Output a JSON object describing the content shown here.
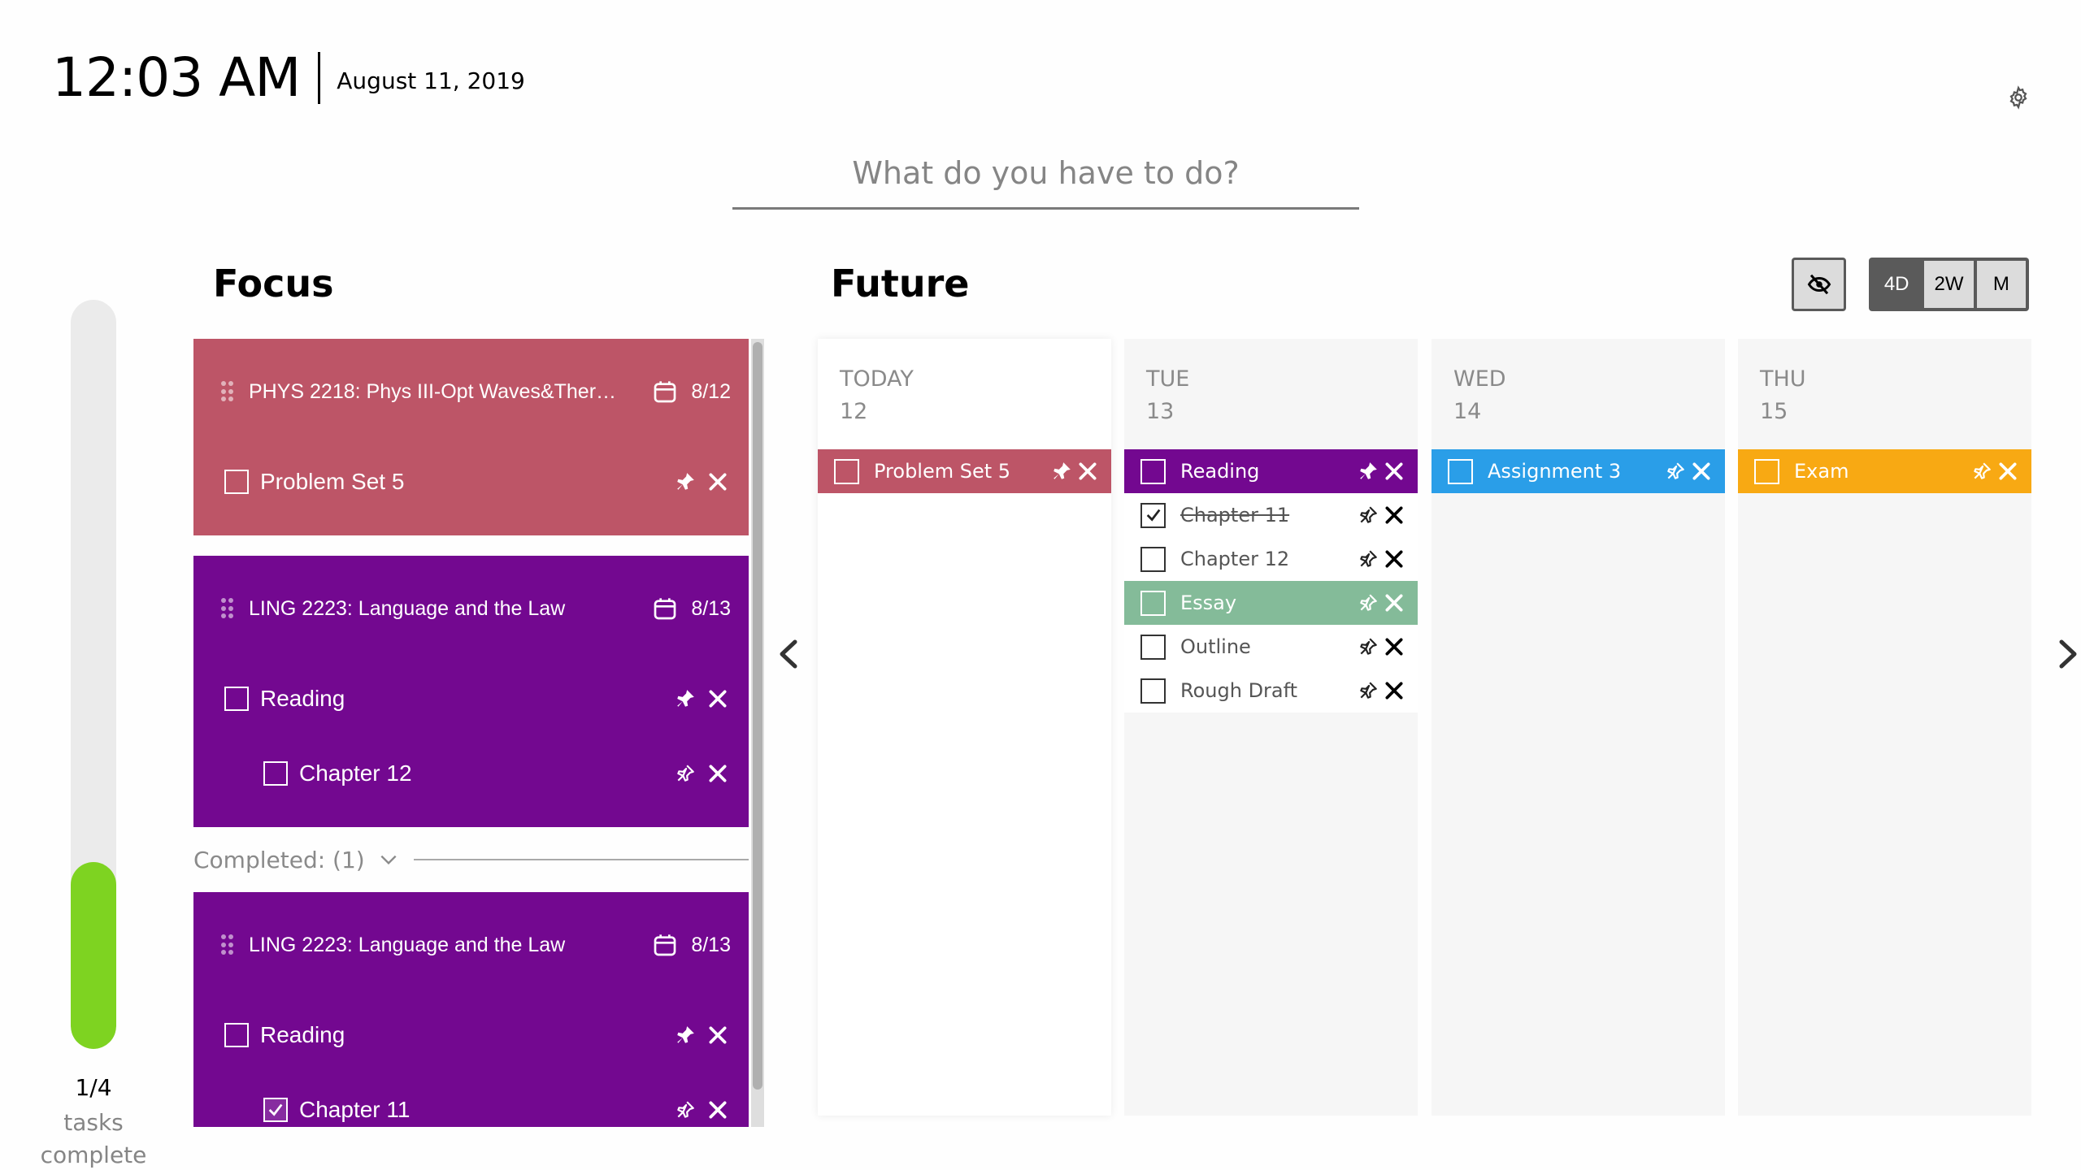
{
  "header": {
    "time": "12:03 AM",
    "date": "August 11, 2019"
  },
  "search": {
    "placeholder": "What do you have to do?",
    "value": ""
  },
  "icons": {
    "settings": "gear-icon",
    "hide_completed": "eye-slash-icon",
    "prev": "chevron-left-icon",
    "next": "chevron-right-icon",
    "due": "calendar-icon",
    "pin": "pin-icon",
    "remove": "close-icon",
    "drag": "drag-handle-icon"
  },
  "colors": {
    "phys": "#bd5567",
    "ling": "#730890",
    "essay": "#84bb99",
    "assignment": "#2a9ee8",
    "exam": "#f8a913",
    "progress": "#7ed321"
  },
  "progress": {
    "completed": 1,
    "total": 4,
    "fraction": 0.25,
    "count_text": "1/4",
    "label": "tasks complete"
  },
  "focus": {
    "title": "Focus",
    "cards": [
      {
        "course": "PHYS 2218: Phys III-Opt Waves&Therm...",
        "due": "8/12",
        "color": "#bd5567",
        "tasks": [
          {
            "label": "Problem Set 5",
            "checked": false,
            "pinned": true,
            "level": 0
          }
        ]
      },
      {
        "course": "LING 2223: Language and the Law",
        "due": "8/13",
        "color": "#730890",
        "tasks": [
          {
            "label": "Reading",
            "checked": false,
            "pinned": true,
            "level": 0
          },
          {
            "label": "Chapter 12",
            "checked": false,
            "pinned": false,
            "level": 1
          }
        ]
      }
    ],
    "completed_label": "Completed: (1)",
    "completed_cards": [
      {
        "course": "LING 2223: Language and the Law",
        "due": "8/13",
        "color": "#730890",
        "tasks": [
          {
            "label": "Reading",
            "checked": false,
            "pinned": true,
            "level": 0
          },
          {
            "label": "Chapter 11",
            "checked": true,
            "pinned": false,
            "level": 1
          }
        ]
      }
    ]
  },
  "future": {
    "title": "Future",
    "view_options": [
      {
        "label": "4D",
        "active": true
      },
      {
        "label": "2W",
        "active": false
      },
      {
        "label": "M",
        "active": false
      }
    ],
    "days": [
      {
        "name": "TODAY",
        "num": "12",
        "today": true,
        "tasks": [
          {
            "label": "Problem Set 5",
            "color": "#bd5567",
            "checked": false,
            "pinned": true
          }
        ]
      },
      {
        "name": "TUE",
        "num": "13",
        "today": false,
        "tasks": [
          {
            "label": "Reading",
            "color": "#730890",
            "checked": false,
            "pinned": true
          },
          {
            "label": "Chapter 11",
            "color": null,
            "checked": true,
            "pinned": false
          },
          {
            "label": "Chapter 12",
            "color": null,
            "checked": false,
            "pinned": false
          },
          {
            "label": "Essay",
            "color": "#84bb99",
            "checked": false,
            "pinned": false
          },
          {
            "label": "Outline",
            "color": null,
            "checked": false,
            "pinned": false
          },
          {
            "label": "Rough Draft",
            "color": null,
            "checked": false,
            "pinned": false
          }
        ]
      },
      {
        "name": "WED",
        "num": "14",
        "today": false,
        "tasks": [
          {
            "label": "Assignment 3",
            "color": "#2a9ee8",
            "checked": false,
            "pinned": false
          }
        ]
      },
      {
        "name": "THU",
        "num": "15",
        "today": false,
        "tasks": [
          {
            "label": "Exam",
            "color": "#f8a913",
            "checked": false,
            "pinned": false
          }
        ]
      }
    ]
  }
}
